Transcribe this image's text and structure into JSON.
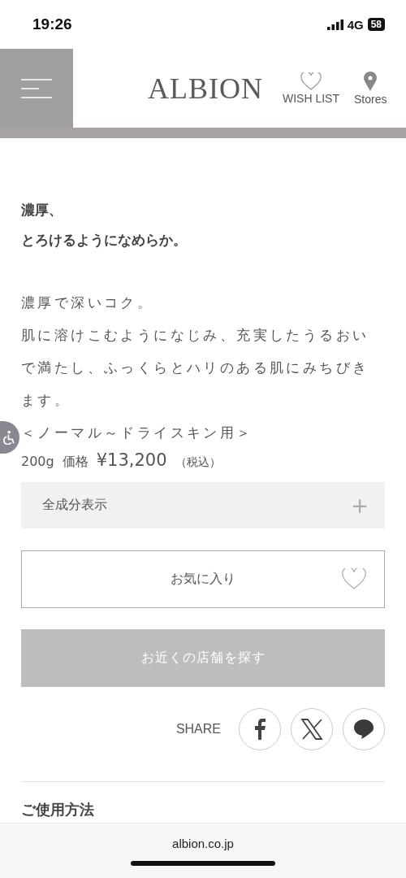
{
  "status_bar": {
    "time": "19:26",
    "network": "4G",
    "battery": "58"
  },
  "header": {
    "logo": "ALBION",
    "wish_list": "WISH LIST",
    "stores": "Stores"
  },
  "headline": [
    "濃厚、",
    "とろけるようになめらか。"
  ],
  "description": [
    "濃厚で深いコク。",
    "肌に溶けこむようになじみ、充実したうるおいで満たし、ふっくらとハリのある肌にみちびきます。",
    "＜ノーマル～ドライスキン用＞"
  ],
  "price": {
    "size": "200g",
    "label": "価格",
    "amount": "¥13,200",
    "tax": "（税込）"
  },
  "ingredients": {
    "label": "全成分表示",
    "expand": "+",
    "expanded": false
  },
  "favorite": {
    "label": "お気に入り"
  },
  "store_button": {
    "label": "お近くの店舗を探す",
    "disabled": true
  },
  "share": {
    "label": "SHARE",
    "networks": [
      {
        "kind": "facebook"
      },
      {
        "kind": "x"
      },
      {
        "kind": "line"
      }
    ]
  },
  "next_heading": "ご使用方法",
  "browser": {
    "url": "albion.co.jp"
  }
}
